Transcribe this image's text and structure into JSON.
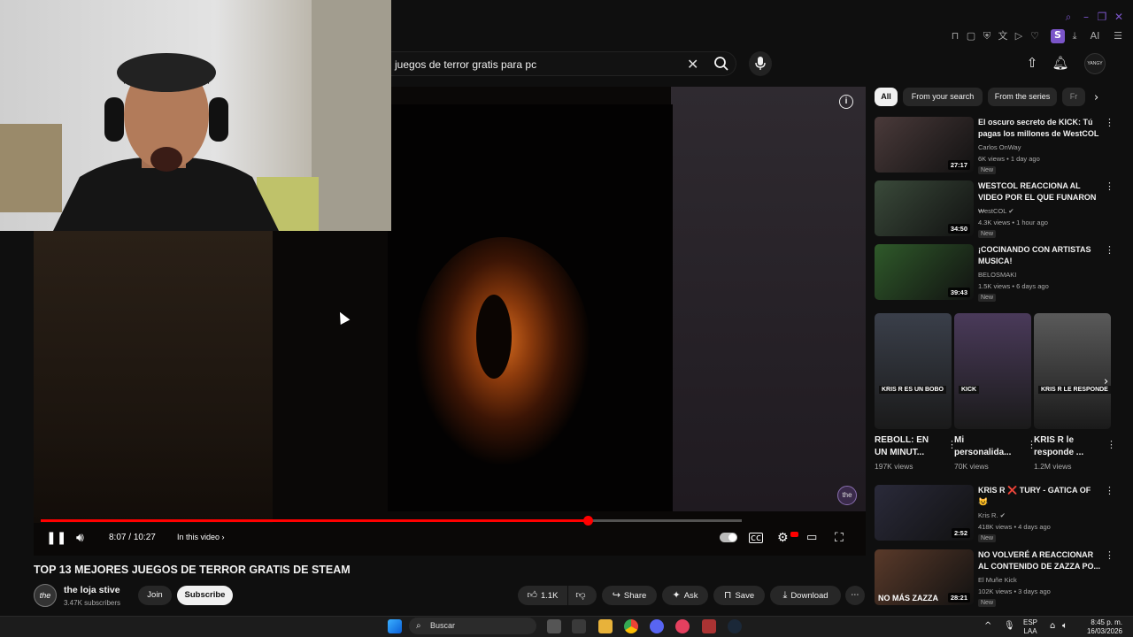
{
  "browser": {
    "window_controls": [
      "search-icon",
      "minimize-icon",
      "restore-icon",
      "close-icon"
    ],
    "profile_initial": "S",
    "ai_label": "AI"
  },
  "search": {
    "query": "juegos de terror gratis para pc"
  },
  "header": {
    "avatar_label": "YANGY"
  },
  "player": {
    "time_current": "8:07",
    "time_total": "10:27",
    "time_sep": " / ",
    "in_this_video": "In this video",
    "progress_fraction": 0.78,
    "watermark": "the"
  },
  "video": {
    "title": "TOP 13 MEJORES JUEGOS DE TERROR GRATIS DE STEAM",
    "channel_name": "the loja stive",
    "channel_subs": "3.47K subscribers",
    "channel_avatar": "the",
    "join_label": "Join",
    "subscribe_label": "Subscribe",
    "likes": "1.1K",
    "share_label": "Share",
    "ask_label": "Ask",
    "save_label": "Save",
    "download_label": "Download"
  },
  "sidebar": {
    "chips": [
      "All",
      "From your search",
      "From the series",
      "Fr"
    ],
    "recs": [
      {
        "title": "El oscuro secreto de KICK: Tú pagas los millones de WestCOL",
        "channel": "Carlos OnWay",
        "views": "6K views",
        "age": "1 day ago",
        "duration": "27:17",
        "badge": "New",
        "verified": false,
        "thumb_color": "#4a3a3a"
      },
      {
        "title": "WESTCOL REACCIONA AL VIDEO POR EL QUE FUNARON ...",
        "channel": "WestCOL",
        "views": "4.3K views",
        "age": "1 hour ago",
        "duration": "34:50",
        "badge": "New",
        "verified": true,
        "thumb_color": "#3a4a3a"
      },
      {
        "title": "¡COCINANDO CON ARTISTAS MUSICA!",
        "channel": "BELOSMAKI",
        "views": "1.5K views",
        "age": "6 days ago",
        "duration": "39:43",
        "badge": "New",
        "verified": false,
        "thumb_color": "#2f5a2a"
      }
    ],
    "shorts": [
      {
        "title": "REBOLL: EN UN MINUT...",
        "views": "197K views",
        "badge": "KRIS R ES UN BOBO",
        "thumb_color": "#3a3f4a"
      },
      {
        "title": "Mi personalida...",
        "views": "70K views",
        "badge": "KICK",
        "thumb_color": "#4a3a5a"
      },
      {
        "title": "KRIS R le responde ...",
        "views": "1.2M views",
        "badge": "KRIS R LE RESPONDE",
        "thumb_color": "#5a5a5a"
      }
    ],
    "recs2": [
      {
        "title": "KRIS R ❌ TURY - GATICA OF 😺",
        "channel": "Kris R.",
        "views": "418K views",
        "age": "4 days ago",
        "duration": "2:52",
        "badge": "New",
        "verified": true,
        "thumb_color": "#2a2a3a"
      },
      {
        "title": "NO VOLVERÉ A REACCIONAR AL CONTENIDO DE ZAZZA PO...",
        "channel": "El Muñe Kick",
        "views": "102K views",
        "age": "3 days ago",
        "duration": "28:21",
        "badge": "New",
        "verified": false,
        "thumb_color": "#5a3a2a",
        "thumb_text": "NO MÁS ZAZZA"
      }
    ]
  },
  "taskbar": {
    "search_placeholder": "Buscar",
    "lang_top": "ESP",
    "lang_bottom": "LAA",
    "time": "8:45 p. m.",
    "date": "16/03/2026"
  },
  "colors": {
    "accent": "#ff0000",
    "background": "#0f0f0f",
    "chip": "#272727",
    "browser_accent": "#7b55c9"
  }
}
